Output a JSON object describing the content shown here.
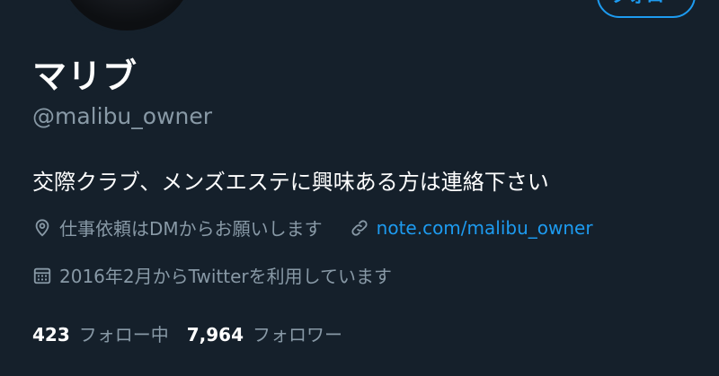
{
  "profile": {
    "follow_button_label": "フォロー",
    "display_name": "マリブ",
    "handle": "@malibu_owner",
    "bio": "交際クラブ、メンズエステに興味ある方は連絡下さい",
    "location": "仕事依頼はDMからお願いします",
    "website": "note.com/malibu_owner",
    "joined": "2016年2月からTwitterを利用しています",
    "following_count": "423",
    "following_label": "フォロー中",
    "followers_count": "7,964",
    "followers_label": "フォロワー"
  },
  "icons": {
    "location": "location-pin-icon",
    "link": "link-icon",
    "calendar": "calendar-icon"
  },
  "colors": {
    "background": "#15202b",
    "accent": "#1d9bf0",
    "secondary_text": "#8899a6",
    "primary_text": "#ffffff"
  }
}
